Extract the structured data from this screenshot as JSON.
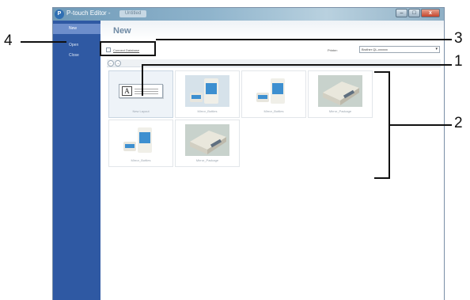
{
  "window": {
    "title": "P-touch Editor -",
    "file_name": "Untitled",
    "controls": [
      "–",
      "□",
      "x"
    ]
  },
  "sidebar": {
    "items": [
      {
        "label": "New",
        "active": true
      },
      {
        "label": "Open",
        "active": false
      },
      {
        "label": "Close",
        "active": false
      }
    ]
  },
  "main": {
    "title": "New",
    "connect_database": "Connect Database",
    "printer_label": "Printer:",
    "printer_value": "Brother QL-xxxxxx",
    "nav": {
      "back": "←",
      "forward": "→"
    }
  },
  "templates": [
    {
      "label": "New Layout",
      "kind": "new",
      "selected": true
    },
    {
      "label": "Mirror_Bottles",
      "kind": "bottles",
      "selected": false
    },
    {
      "label": "Mirror_Bottles",
      "kind": "bottles",
      "selected": false
    },
    {
      "label": "Mirror_Package",
      "kind": "package",
      "selected": false
    },
    {
      "label": "Mirror_Bottles",
      "kind": "bottles",
      "selected": false
    },
    {
      "label": "Mirror_Package",
      "kind": "package",
      "selected": false
    }
  ],
  "callouts": {
    "one": "1",
    "two": "2",
    "three": "3",
    "four": "4"
  },
  "colors": {
    "sidebar": "#2f59a3",
    "sidebar_active": "#6d8ecb",
    "titlebar": "#8fb4cc",
    "bottle_label": "#3d8fd0"
  }
}
